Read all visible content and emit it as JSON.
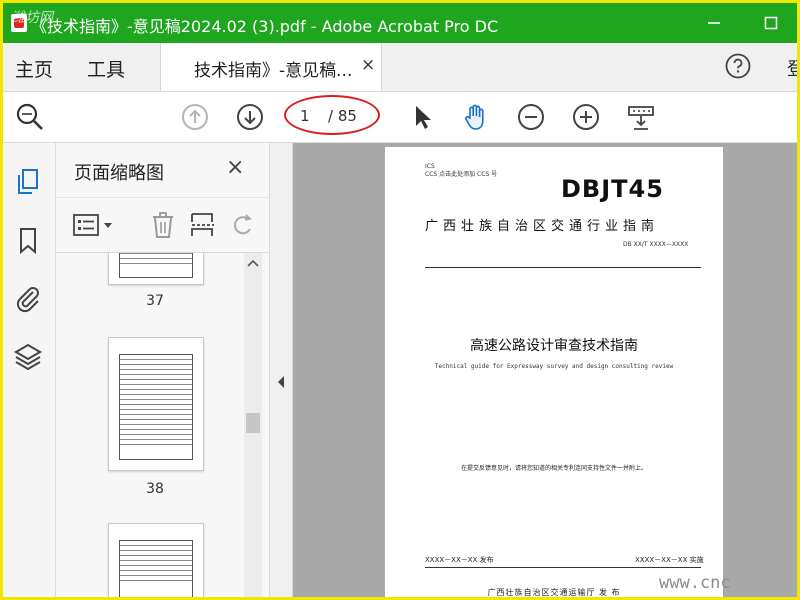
{
  "window": {
    "title": "《技术指南》-意见稿2024.02 (3).pdf - Adobe Acrobat Pro DC",
    "watermark": "潍坊网"
  },
  "menubar": {
    "home": "主页",
    "tools": "工具",
    "tab_label": "技术指南》-意见稿...",
    "tab_close": "×",
    "cut_text": "登"
  },
  "toolbar": {
    "current_page": "1",
    "page_total": "/ 85"
  },
  "thumbnails": {
    "title": "页面缩略图",
    "close": "×",
    "pages": [
      "37",
      "38"
    ]
  },
  "document": {
    "ics_line1": "ICS",
    "ics_line2": "CCS  点击此处添加 CCS 号",
    "standard_code": "DBJT45",
    "guide_header": "广西壮族自治区交通行业指南",
    "doc_number": "DB XX/T XXXX—XXXX",
    "title_cn": "高速公路设计审查技术指南",
    "title_en": "Technical guide for Expressway survey and design consulting review",
    "note": "在提交反馈意见时，请将您知道的相关专利连同支持性文件一并附上。",
    "publish_date": "XXXX－XX－XX 发布",
    "implement_date": "XXXX－XX－XX 实施",
    "issuer": "广西壮族自治区交通运输厅    发 布"
  },
  "site_watermark": "www.cnc",
  "colors": {
    "titlebar": "#1fa61f",
    "frame": "#f2e600",
    "annotation": "#d81e1e",
    "docbg": "#a9a9a9"
  }
}
